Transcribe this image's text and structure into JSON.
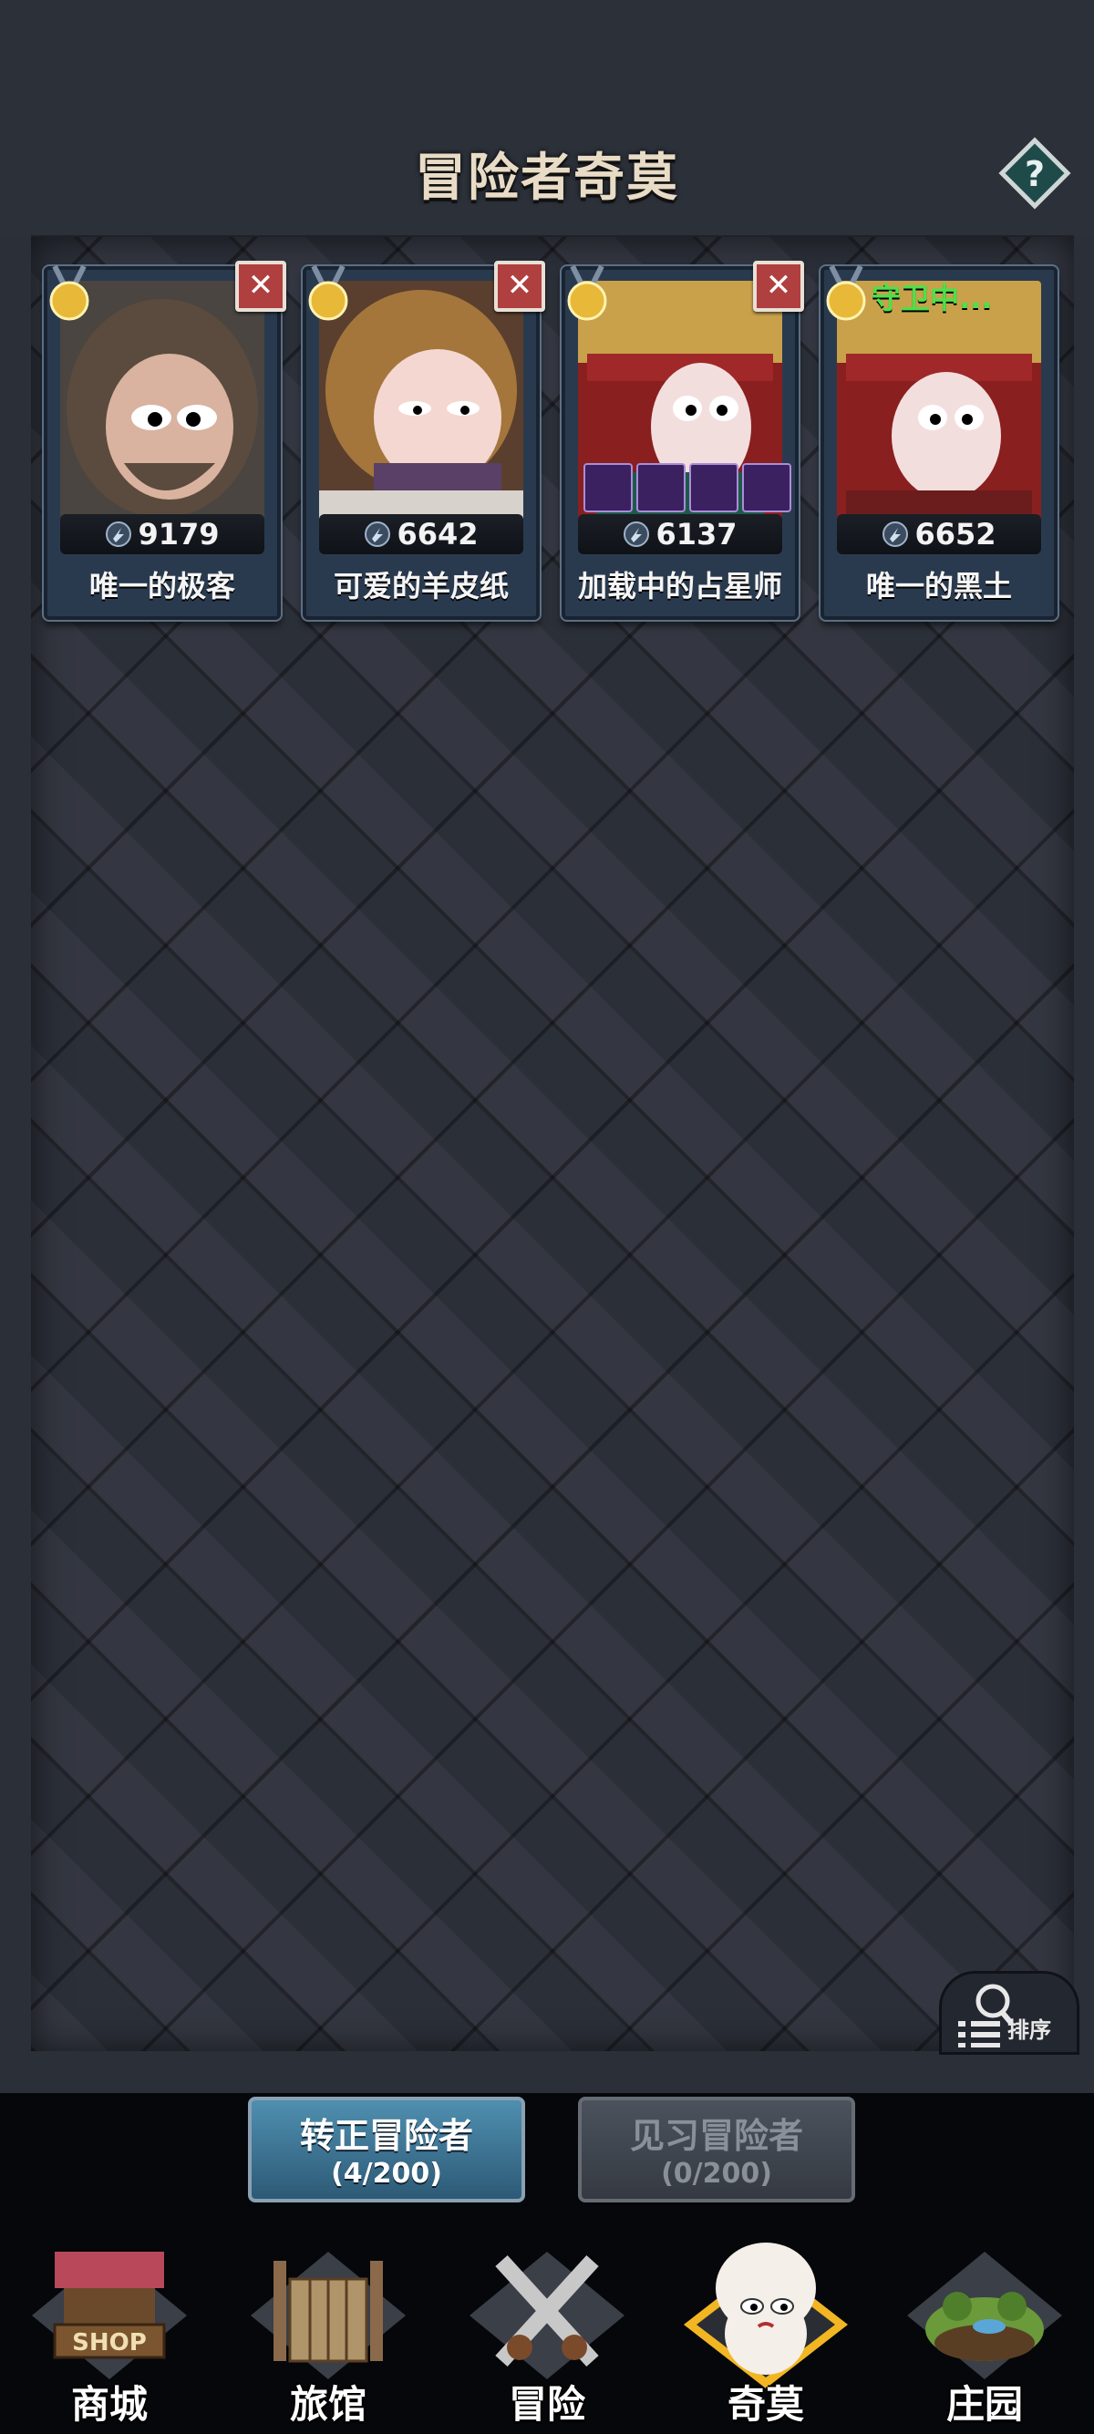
{
  "header": {
    "title": "冒险者奇莫",
    "help_label": "?"
  },
  "cards": [
    {
      "name": "唯一的极客",
      "power": "9179",
      "removable": true,
      "status": ""
    },
    {
      "name": "可爱的羊皮纸",
      "power": "6642",
      "removable": true,
      "status": ""
    },
    {
      "name": "加载中的占星师",
      "power": "6137",
      "removable": true,
      "status": ""
    },
    {
      "name": "唯一的黑土",
      "power": "6652",
      "removable": false,
      "status": "守卫中..."
    }
  ],
  "close_glyph": "✕",
  "sort": {
    "label": "排序"
  },
  "tabs": [
    {
      "label": "转正冒险者",
      "count": "(4/200)",
      "active": true
    },
    {
      "label": "见习冒险者",
      "count": "(0/200)",
      "active": false
    }
  ],
  "nav": [
    {
      "label": "商城",
      "sign": "SHOP"
    },
    {
      "label": "旅馆"
    },
    {
      "label": "冒险"
    },
    {
      "label": "奇莫",
      "active": true
    },
    {
      "label": "庄园"
    }
  ],
  "colors": {
    "accent_active": "#f2b623",
    "guard_green": "#4ee04a",
    "close_red": "#b04040"
  }
}
